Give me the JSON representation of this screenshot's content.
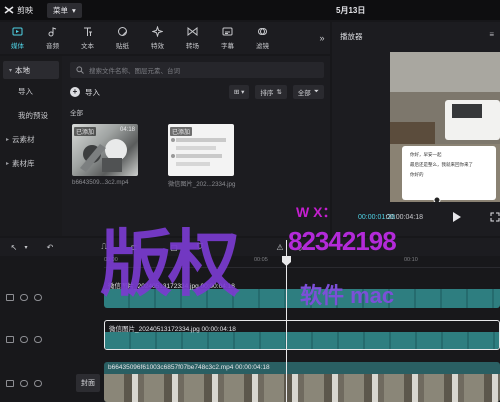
{
  "titlebar": {
    "app_name": "剪映",
    "menu_label": "菜单",
    "date": "5月13日"
  },
  "toolbar": {
    "tools": [
      {
        "label": "媒体",
        "icon": "media-icon",
        "active": true
      },
      {
        "label": "音频",
        "icon": "audio-icon",
        "active": false
      },
      {
        "label": "文本",
        "icon": "text-icon",
        "active": false
      },
      {
        "label": "贴纸",
        "icon": "sticker-icon",
        "active": false
      },
      {
        "label": "特效",
        "icon": "effects-icon",
        "active": false
      },
      {
        "label": "转场",
        "icon": "transition-icon",
        "active": false
      },
      {
        "label": "字幕",
        "icon": "caption-icon",
        "active": false
      },
      {
        "label": "滤镜",
        "icon": "filter-icon",
        "active": false
      }
    ],
    "more": "»"
  },
  "leftnav": {
    "items": [
      {
        "label": "本地",
        "caret": "▾"
      },
      {
        "label": "导入",
        "caret": ""
      },
      {
        "label": "我的预设",
        "caret": ""
      },
      {
        "label": "云素材",
        "caret": "▸"
      },
      {
        "label": "素材库",
        "caret": "▸"
      }
    ]
  },
  "media": {
    "search_placeholder": "搜索文件名称、图层元素、台词",
    "import_label": "导入",
    "view_label": "⊞ ▾",
    "sort_label": "排序",
    "filter_label": "全部",
    "section_label": "全部",
    "items": [
      {
        "tag": "已添加",
        "duration": "04:18",
        "caption": "b6643509...3c2.mp4"
      },
      {
        "tag": "已添加",
        "duration": "",
        "caption": "微信图片_202...2334.jpg"
      }
    ]
  },
  "player": {
    "title": "播放器",
    "menu": "≡",
    "current_time": "00:00:01:26",
    "total_time": "00:00:04:18",
    "chat_lines": [
      "你好，早安一起",
      "最后还是整么，我就来回你来了",
      "你好的"
    ]
  },
  "timeline": {
    "ruler": [
      "00:00",
      "00:05",
      "00:10"
    ],
    "cover_label": "封面",
    "tracks": [
      {
        "label": "微信图片_20240513172334.jpg  00:00:04:18"
      },
      {
        "label": "微信图片_20240513172334.jpg  00:00:04:18"
      },
      {
        "label": "b66435096f61003c6857f07be748c3c2.mp4  00:00:04:18"
      }
    ]
  },
  "watermark": {
    "big": "版权",
    "wx": "W X：",
    "number": "82342198",
    "small": "软件 mac"
  },
  "colors": {
    "accent": "#4fd3e6",
    "clip": "#2e7e80",
    "watermark": "#7a3bd0"
  }
}
